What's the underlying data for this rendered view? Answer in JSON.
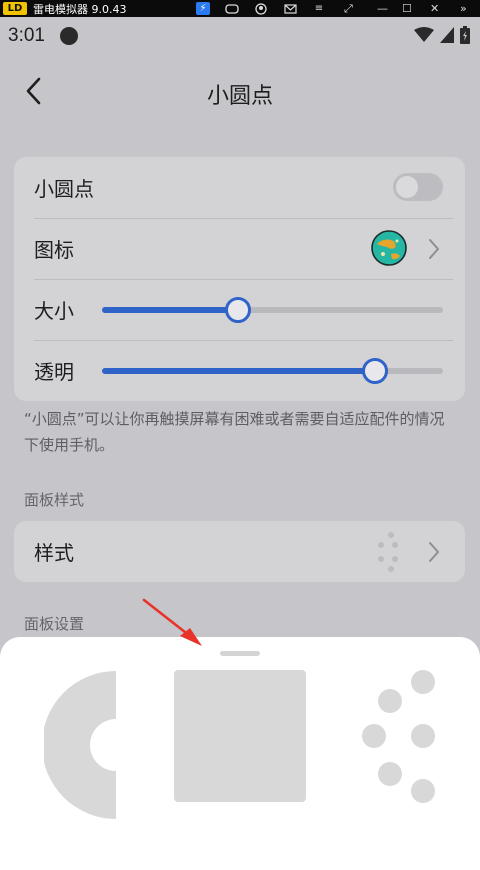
{
  "emulator": {
    "title": "雷电模拟器 9.0.43",
    "logo": "LD"
  },
  "status_bar": {
    "time": "3:01"
  },
  "header": {
    "title": "小圆点",
    "back_icon": "chevron-left-icon"
  },
  "settings": {
    "toggle_row": {
      "label": "小圆点",
      "enabled": false
    },
    "icon_row": {
      "label": "图标",
      "icon": "planet-globe-icon"
    },
    "size_row": {
      "label": "大小",
      "value_percent": 40
    },
    "opacity_row": {
      "label": "透明",
      "value_percent": 80
    }
  },
  "description": "“小圆点”可以让你再触摸屏幕有困难或者需要自适应配件的情况下使用手机。",
  "panel_style": {
    "section_title": "面板样式",
    "row_label": "样式",
    "icon": "dots-pattern-icon"
  },
  "panel_settings": {
    "section_title": "面板设置"
  },
  "bottom_sheet": {
    "options": [
      "c-shape-layout",
      "square-layout",
      "dots-layout"
    ]
  },
  "colors": {
    "accent": "#2f63c8",
    "annotation_arrow": "#e8332a"
  }
}
